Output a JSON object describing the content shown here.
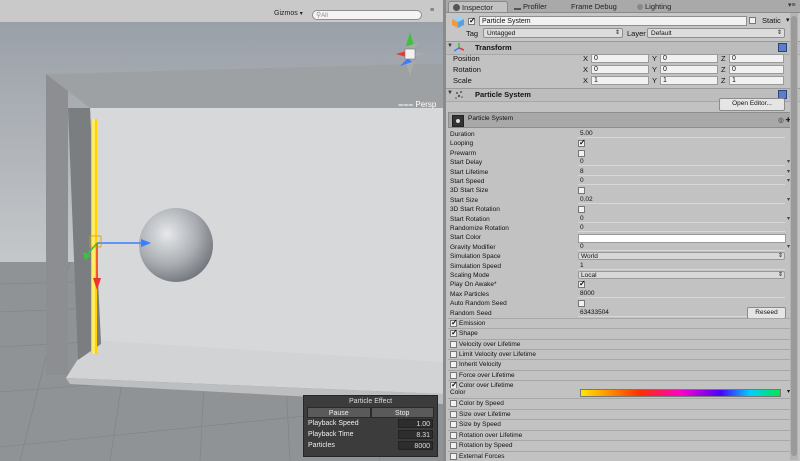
{
  "scene": {
    "gizmos_label": "Gizmos",
    "search_placeholder": "All",
    "persp_label": "Persp"
  },
  "particle_effect": {
    "title": "Particle Effect",
    "pause_label": "Pause",
    "stop_label": "Stop",
    "rows": [
      {
        "label": "Playback Speed",
        "value": "1.00"
      },
      {
        "label": "Playback Time",
        "value": "8.31"
      },
      {
        "label": "Particles",
        "value": "8000"
      }
    ]
  },
  "tabs": {
    "inspector": "Inspector",
    "profiler": "Profiler",
    "frame_debug": "Frame Debug",
    "lighting": "Lighting"
  },
  "object": {
    "name": "Particle System",
    "static_label": "Static",
    "tag_label": "Tag",
    "tag_value": "Untagged",
    "layer_label": "Layer",
    "layer_value": "Default"
  },
  "transform": {
    "title": "Transform",
    "rows": [
      {
        "label": "Position",
        "x": "0",
        "y": "0",
        "z": "0"
      },
      {
        "label": "Rotation",
        "x": "0",
        "y": "0",
        "z": "0"
      },
      {
        "label": "Scale",
        "x": "1",
        "y": "1",
        "z": "1"
      }
    ],
    "axes": [
      "X",
      "Y",
      "Z"
    ]
  },
  "particle_system": {
    "title": "Particle System",
    "open_editor": "Open Editor...",
    "main_label": "Particle System",
    "reseed": "Reseed",
    "props": [
      {
        "label": "Duration",
        "value": "5.00",
        "kind": "num"
      },
      {
        "label": "Looping",
        "kind": "cb",
        "checked": true
      },
      {
        "label": "Prewarm",
        "kind": "cb",
        "checked": false
      },
      {
        "label": "Start Delay",
        "value": "0",
        "kind": "num",
        "caret": true
      },
      {
        "label": "Start Lifetime",
        "value": "8",
        "kind": "num",
        "caret": true
      },
      {
        "label": "Start Speed",
        "value": "0",
        "kind": "num",
        "caret": true
      },
      {
        "label": "3D Start Size",
        "kind": "cb",
        "checked": false
      },
      {
        "label": "Start Size",
        "value": "0.02",
        "kind": "num",
        "caret": true
      },
      {
        "label": "3D Start Rotation",
        "kind": "cb",
        "checked": false
      },
      {
        "label": "Start Rotation",
        "value": "0",
        "kind": "num",
        "caret": true
      },
      {
        "label": "Randomize Rotation",
        "value": "0",
        "kind": "num"
      },
      {
        "label": "Start Color",
        "kind": "color"
      },
      {
        "label": "Gravity Modifier",
        "value": "0",
        "kind": "num",
        "caret": true
      },
      {
        "label": "Simulation Space",
        "value": "World",
        "kind": "sel"
      },
      {
        "label": "Simulation Speed",
        "value": "1",
        "kind": "num"
      },
      {
        "label": "Scaling Mode",
        "value": "Local",
        "kind": "sel"
      },
      {
        "label": "Play On Awake*",
        "kind": "cb",
        "checked": true
      },
      {
        "label": "Max Particles",
        "value": "8000",
        "kind": "num"
      },
      {
        "label": "Auto Random Seed",
        "kind": "cb",
        "checked": false
      },
      {
        "label": "Random Seed",
        "value": "63433504",
        "kind": "num"
      }
    ],
    "modules": [
      {
        "label": "Emission",
        "checked": true
      },
      {
        "label": "Shape",
        "checked": true
      },
      {
        "label": "Velocity over Lifetime",
        "checked": false
      },
      {
        "label": "Limit Velocity over Lifetime",
        "checked": false
      },
      {
        "label": "Inherit Velocity",
        "checked": false
      },
      {
        "label": "Force over Lifetime",
        "checked": false
      },
      {
        "label": "Color over Lifetime",
        "checked": true
      }
    ],
    "color_label": "Color",
    "modules_after": [
      {
        "label": "Color by Speed",
        "checked": false
      },
      {
        "label": "Size over Lifetime",
        "checked": false
      },
      {
        "label": "Size by Speed",
        "checked": false
      },
      {
        "label": "Rotation over Lifetime",
        "checked": false
      },
      {
        "label": "Rotation by Speed",
        "checked": false
      },
      {
        "label": "External Forces",
        "checked": false
      }
    ]
  },
  "colors": {
    "play_bg": "#3c3c3c",
    "gradient": [
      "#ffe600",
      "#ff2d00",
      "#ff00c8",
      "#4a00ff",
      "#00d0ff",
      "#00e64a"
    ]
  }
}
